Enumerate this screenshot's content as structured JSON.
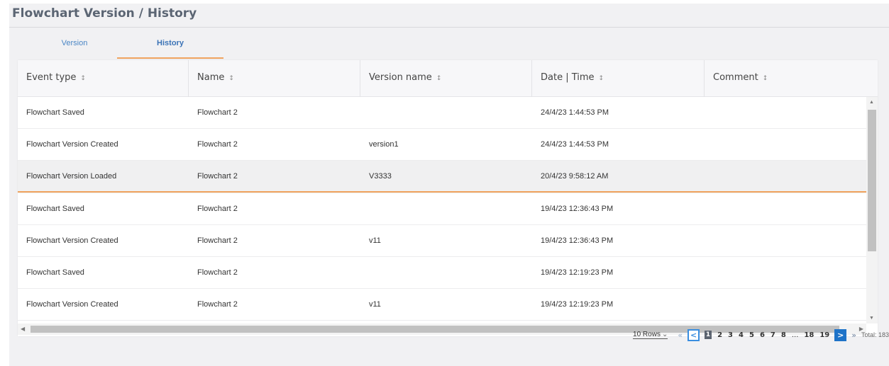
{
  "header": {
    "title": "Flowchart Version / History"
  },
  "tabs": [
    {
      "label": "Version",
      "active": false
    },
    {
      "label": "History",
      "active": true
    }
  ],
  "table": {
    "sort_icon": "↕",
    "columns": [
      "Event type",
      "Name",
      "Version name",
      "Date | Time",
      "Comment"
    ],
    "rows": [
      {
        "event_type": "Flowchart Saved",
        "name": "Flowchart 2",
        "version_name": "",
        "date_time": "24/4/23 1:44:53 PM",
        "comment": ""
      },
      {
        "event_type": "Flowchart Version Created",
        "name": "Flowchart 2",
        "version_name": "version1",
        "date_time": "24/4/23 1:44:53 PM",
        "comment": ""
      },
      {
        "event_type": "Flowchart Version Loaded",
        "name": "Flowchart 2",
        "version_name": "V3333",
        "date_time": "20/4/23 9:58:12 AM",
        "comment": "",
        "selected": true
      },
      {
        "event_type": "Flowchart Saved",
        "name": "Flowchart 2",
        "version_name": "",
        "date_time": "19/4/23 12:36:43 PM",
        "comment": ""
      },
      {
        "event_type": "Flowchart Version Created",
        "name": "Flowchart 2",
        "version_name": "v11",
        "date_time": "19/4/23 12:36:43 PM",
        "comment": ""
      },
      {
        "event_type": "Flowchart Saved",
        "name": "Flowchart 2",
        "version_name": "",
        "date_time": "19/4/23 12:19:23 PM",
        "comment": ""
      },
      {
        "event_type": "Flowchart Version Created",
        "name": "Flowchart 2",
        "version_name": "v11",
        "date_time": "19/4/23 12:19:23 PM",
        "comment": ""
      }
    ]
  },
  "pagination": {
    "rows_per_page": "10 Rows",
    "first_icon": "«",
    "prev_icon": "<",
    "next_icon": ">",
    "last_icon": "»",
    "pages": [
      "1",
      "2",
      "3",
      "4",
      "5",
      "6",
      "7",
      "8"
    ],
    "ellipsis": "...",
    "last_pages": [
      "18",
      "19"
    ],
    "current_page": "1",
    "total": "Total: 183"
  },
  "colors": {
    "accent_orange": "#f0a35e",
    "link_blue": "#3b73b6",
    "nav_blue": "#1e73c8"
  }
}
